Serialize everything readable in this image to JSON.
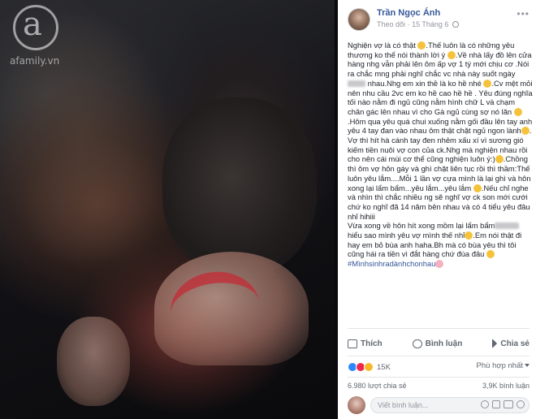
{
  "watermark": {
    "letter": "a",
    "site": "afamily.vn"
  },
  "post": {
    "author": "Trần Ngọc Ánh",
    "follow_label": "Theo dõi",
    "separator": "·",
    "date": "15 Tháng 6",
    "more_label": "•••",
    "text": {
      "p1": "Nghiện vợ là có thật ",
      "p2": ".Thế luôn là có những yêu thương ko thể nói thành lời ý ",
      "p3": ".Về nhà lấy đồ lên cửa hàng nhg vẫn phải lên ôm ấp vợ 1 tý mới chịu cơ .Nói ra chắc mng phải nghĩ chắc vc nhà này suốt ngày ",
      "p4": " nhau",
      "p5": ".Nhg em xin thề là ko hề nhé ",
      "p6": ".Cv mệt mỏi nên nhu cầu 2vc em ko hề cao hề hề . Yêu đúng nghĩa tối nào nằm đi ngủ cũng nằm hình chữ L và chạm chân gác lên nhau vì cho Gà ngủ cùng sợ nó lăn ",
      "p7": ".Hôm qua yêu quá chui xuống nằm gối đầu lên tay anh yêu 4 tay đan vào nhau ôm thật chặt ngủ ngon lành",
      "p8": ". Vợ thì hít hà cánh tay đen nhẻm xấu xí vì sương gió kiếm tiền nuôi vợ con của ck.Nhg mà nghiện nhau rồi cho nên cái mùi cơ thể cũng nghiện luôn ý:)",
      "p9": ".Chồng thì ôm vợ hôn gáy và ghì chặt liên tục rồi thì thầm:Thế luôn yêu lắm....Mỗi 1 lần vợ cựa mình là lại ghì và hôn xong lại lẩm bẩm...yêu lắm...yêu lắm ",
      "p10": ".Nếu chỉ nghe và nhìn thì chắc nhiều ng sẽ nghĩ vợ ck son mới cưới chứ ko nghĩ đã 14 năm bên nhau và có 4 tiểu yêu đâu nhỉ hihiii",
      "p11": "Vừa xong về hôn hít xong mồm lại lẩm bẩm",
      "p12": " hiểu sao mình yêu vợ mình thế nhỉ",
      "p13": ".Em nói thật đi hay em bỏ bùa anh haha.Bh mà có bùa yêu thì tôi cũng hái ra tiền vì đắt hàng chứ đùa đâu ",
      "hashtag": "#Mìnhsinhradànhchonhau"
    },
    "actions": {
      "like": "Thích",
      "comment": "Bình luận",
      "share": "Chia sẻ"
    },
    "reactions": {
      "count": "15K",
      "sort_label": "Phù hợp nhất"
    },
    "stats": {
      "shares": "6.980 lượt chia sẻ",
      "comments": "3,9K bình luận"
    },
    "comment_placeholder": "Viết bình luận..."
  },
  "colors": {
    "link": "#365899",
    "text": "#1d2129",
    "muted": "#90949c",
    "like": "#2d88ff",
    "love": "#f0284a",
    "haha": "#f7b928"
  },
  "icons": [
    "globe-icon",
    "more-icon",
    "like-icon",
    "comment-icon",
    "share-icon",
    "emoji-icon",
    "camera-icon",
    "gif-icon",
    "sticker-icon"
  ]
}
